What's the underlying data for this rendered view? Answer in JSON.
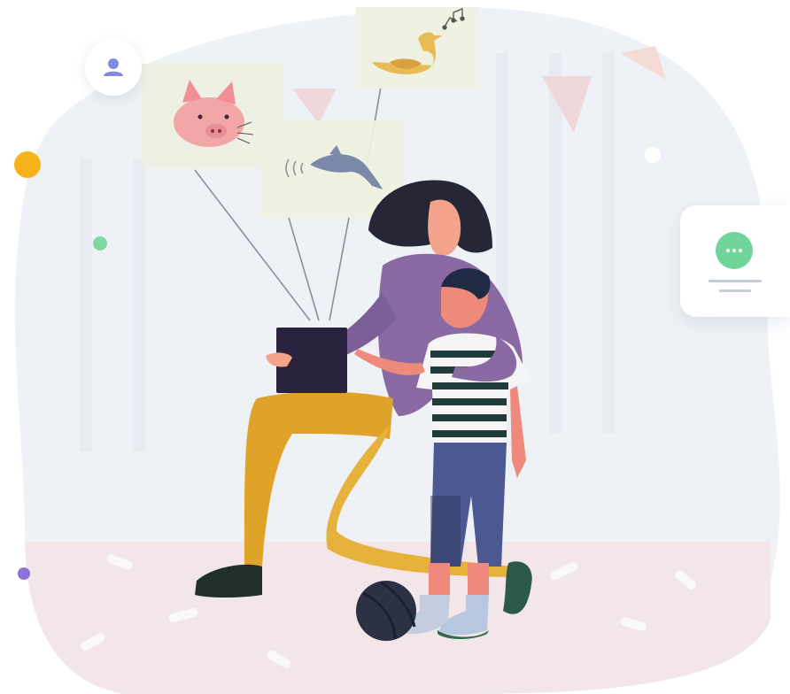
{
  "illustration": {
    "colors": {
      "background_blob": "#eef1f5",
      "floor": "#f2e6e8",
      "sweater": "#8a6aa3",
      "pants": "#e0a32a",
      "tablet": "#2a2340",
      "boy_jeans": "#4b5891",
      "ball": "#2c3244",
      "accent_green": "#6fd59a",
      "accent_orange": "#f6b31b",
      "accent_purple": "#8a72d8"
    },
    "cards": [
      "pig-card",
      "dolphin-card",
      "duck-card"
    ],
    "icons": [
      "user-icon",
      "chat-bubble-icon",
      "pig-icon",
      "dolphin-icon",
      "duck-icon",
      "music-notes-icon"
    ]
  }
}
